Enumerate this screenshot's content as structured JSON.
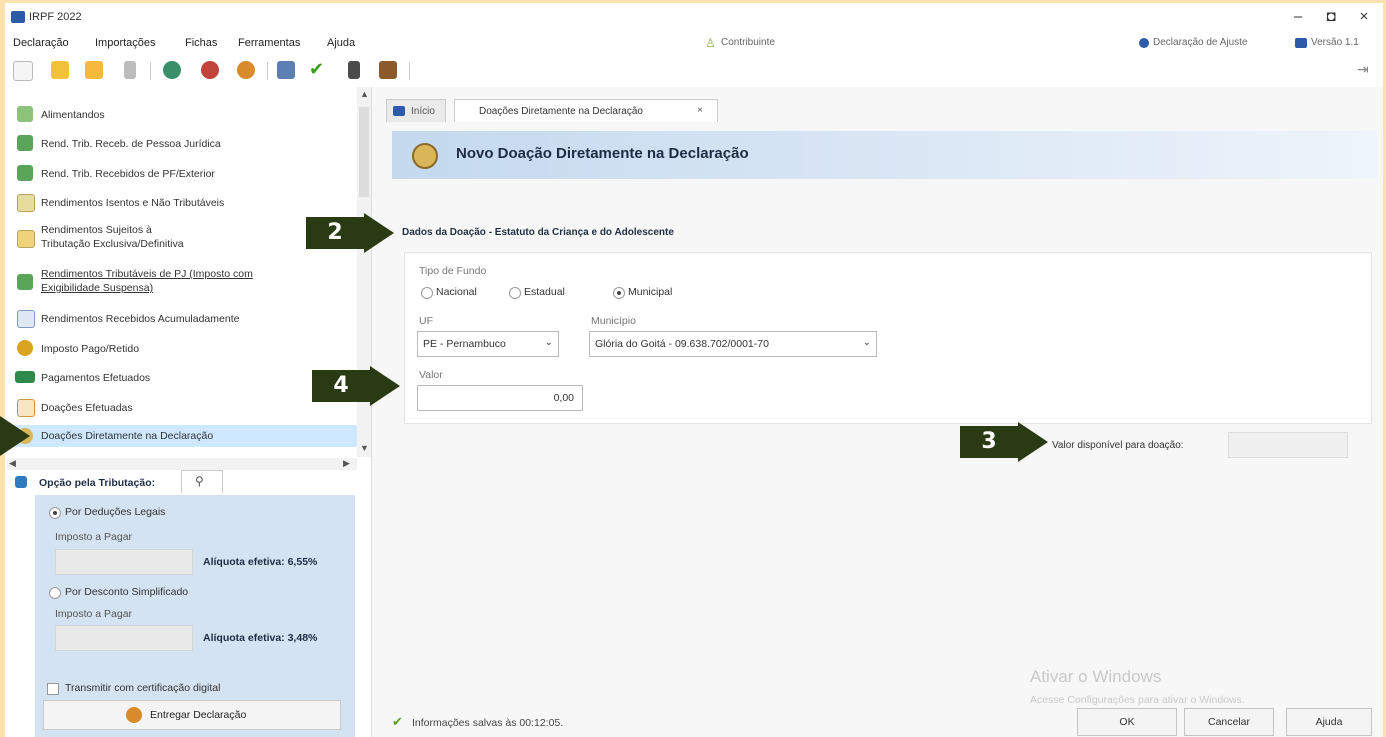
{
  "window": {
    "title": "IRPF 2022",
    "minimize": "–",
    "maximize": "◘",
    "close": "×"
  },
  "menu": {
    "items": [
      "Declaração",
      "Importações",
      "Fichas",
      "Ferramentas",
      "Ajuda"
    ],
    "contributor": "Contribuinte",
    "adjust": "Declaração de Ajuste",
    "version": "Versão 1.1"
  },
  "sidebar": {
    "items": [
      {
        "label": "Alimentandos",
        "icon": "people-icon"
      },
      {
        "label": "Rend. Trib. Receb. de Pessoa Jurídica",
        "icon": "money-icon"
      },
      {
        "label": "Rend. Trib. Recebidos de PF/Exterior",
        "icon": "money-icon"
      },
      {
        "label": "Rendimentos Isentos e Não Tributáveis",
        "icon": "document-icon"
      },
      {
        "label": "Rendimentos Sujeitos à Tributação Exclusiva/Definitiva",
        "icon": "document-icon"
      },
      {
        "label": "Rendimentos Tributáveis de PJ (Imposto com Exigibilidade Suspensa)",
        "icon": "money-icon"
      },
      {
        "label": "Rendimentos Recebidos Acumuladamente",
        "icon": "document-icon"
      },
      {
        "label": "Imposto Pago/Retido",
        "icon": "coin-icon"
      },
      {
        "label": "Pagamentos Efetuados",
        "icon": "card-icon"
      },
      {
        "label": "Doações Efetuadas",
        "icon": "gift-icon"
      },
      {
        "label": "Doações Diretamente na Declaração",
        "icon": "hand-icon"
      }
    ],
    "option": {
      "title": "Opção pela Tributação:",
      "legal": "Por Deduções Legais",
      "tax_label": "Imposto a Pagar",
      "rate_legal": "Alíquota efetiva: 6,55%",
      "simplified": "Por Desconto Simplificado",
      "rate_simplified": "Alíquota efetiva: 3,48%",
      "digital_cert": "Transmitir com certificação digital",
      "deliver": "Entregar Declaração"
    }
  },
  "tabs": {
    "home": "Início",
    "active": "Doações Diretamente na Declaração"
  },
  "main": {
    "header_title": "Novo Doação Diretamente na Declaração",
    "section_title": "Dados da Doação - Estatuto da Criança e do Adolescente",
    "fund_type_label": "Tipo de Fundo",
    "fund_options": [
      "Nacional",
      "Estadual",
      "Municipal"
    ],
    "fund_selected": "Municipal",
    "uf_label": "UF",
    "uf_value": "PE - Pernambuco",
    "municipality_label": "Município",
    "municipality_value": "Glória do Goitá - 09.638.702/0001-70",
    "value_label": "Valor",
    "value": "0,00",
    "available_label": "Valor disponível para doação:",
    "status": "Informações salvas às 00:12:05.",
    "ok": "OK",
    "cancel": "Cancelar",
    "help": "Ajuda"
  },
  "annotations": [
    "2",
    "3",
    "4"
  ],
  "watermark": {
    "line1": "Ativar o Windows",
    "line2": "Acesse Configurações para ativar o Windows."
  }
}
